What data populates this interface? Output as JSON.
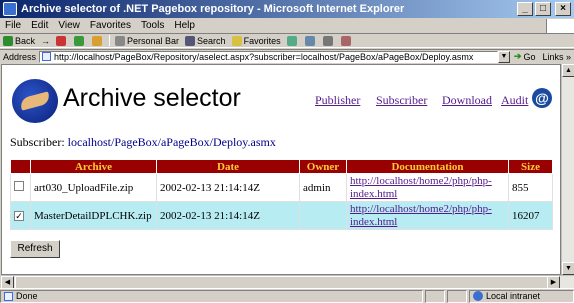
{
  "window": {
    "title": "Archive selector of .NET Pagebox repository - Microsoft Internet Explorer",
    "minimize": "_",
    "maximize": "□",
    "close": "×"
  },
  "menu": [
    "File",
    "Edit",
    "View",
    "Favorites",
    "Tools",
    "Help"
  ],
  "toolbar": {
    "back": "Back",
    "forward": "→",
    "personal_bar": "Personal Bar",
    "search": "Search",
    "favorites": "Favorites"
  },
  "address": {
    "label": "Address",
    "value": "http://localhost/PageBox/Repository/aselect.aspx?subscriber=localhost/PageBox/aPageBox/Deploy.asmx",
    "go": "Go",
    "links": "Links »"
  },
  "page": {
    "title": "Archive selector",
    "nav": [
      "Publisher",
      "Subscriber",
      "Download",
      "Audit"
    ],
    "subscriber_label": "Subscriber:",
    "subscriber_value": "localhost/PageBox/aPageBox/Deploy.asmx",
    "refresh_label": "Refresh"
  },
  "table": {
    "headers": [
      "",
      "Archive",
      "Date",
      "Owner",
      "Documentation",
      "Size"
    ],
    "rows": [
      {
        "checked": false,
        "archive": "art030_UploadFile.zip",
        "date": "2002-02-13 21:14:14Z",
        "owner": "admin",
        "doc": "http://localhost/home2/php/php-index.html",
        "size": "855"
      },
      {
        "checked": true,
        "archive": "MasterDetailDPLCHK.zip",
        "date": "2002-02-13 21:14:14Z",
        "owner": "",
        "doc": "http://localhost/home2/php/php-index.html",
        "size": "16207"
      }
    ]
  },
  "status": {
    "text": "Done",
    "zone": "Local intranet"
  }
}
